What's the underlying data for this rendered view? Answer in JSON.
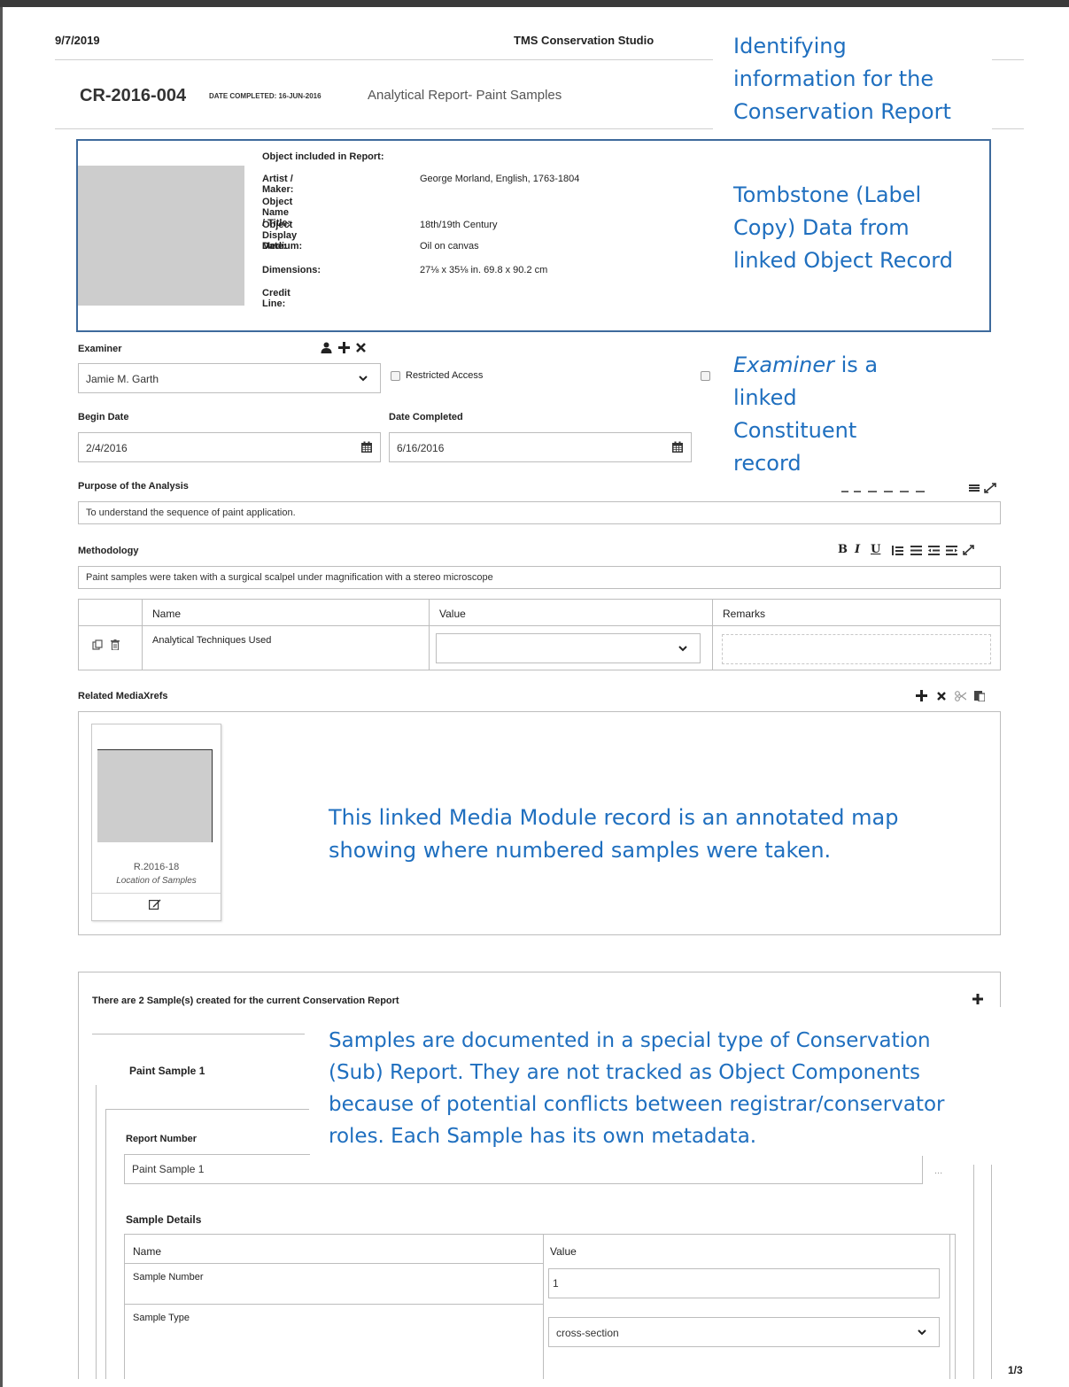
{
  "header": {
    "date": "9/7/2019",
    "studio": "TMS Conservation Studio",
    "report_id": "CR-2016-004",
    "date_completed_label": "DATE COMPLETED: 16-JUN-2016",
    "report_title": "Analytical Report- Paint Samples"
  },
  "annotations": {
    "identifying": [
      "Identifying",
      "information for the",
      "Conservation Report"
    ],
    "tombstone": [
      "Tombstone (Label",
      "Copy) Data from",
      "linked Object Record"
    ],
    "examiner_em": "Examiner",
    "examiner_rest": " is a",
    "examiner_lines": [
      "linked",
      "Constituent",
      "record"
    ],
    "media": [
      "This linked Media Module record is an annotated map",
      "showing where numbered samples were taken."
    ],
    "samples": [
      "Samples are documented in a special type of Conservation",
      "(Sub) Report.  They are not tracked as Object Components",
      "because of potential conflicts between registrar/conservator",
      "roles.  Each Sample has its own metadata."
    ]
  },
  "object": {
    "heading": "Object included in Report:",
    "rows": [
      {
        "label": "Artist / Maker:",
        "value": "George Morland, English, 1763-1804"
      },
      {
        "label": "Object Name / Title:",
        "value": ""
      },
      {
        "label": "Object Display Date:",
        "value": "18th/19th Century"
      },
      {
        "label": "Medium:",
        "value": "Oil on canvas"
      },
      {
        "label": "Dimensions:",
        "value": "27⅛ x 35⅛ in. 69.8 x 90.2 cm"
      },
      {
        "label": "Credit Line:",
        "value": ""
      }
    ]
  },
  "form": {
    "examiner_label": "Examiner",
    "examiner_value": "Jamie M. Garth",
    "restricted_label": "Restricted Access",
    "begin_date_label": "Begin Date",
    "begin_date_value": "2/4/2016",
    "date_completed_label": "Date Completed",
    "date_completed_value": "6/16/2016",
    "purpose_label": "Purpose of the Analysis",
    "purpose_value": "To understand the sequence of paint application.",
    "methodology_label": "Methodology",
    "methodology_value": "Paint samples were taken with a surgical scalpel under magnification with a stereo microscope",
    "toolbar": [
      "B",
      "I",
      "U"
    ]
  },
  "attributes_table": {
    "headers": [
      "Name",
      "Value",
      "Remarks"
    ],
    "rows": [
      {
        "name": "Analytical Techniques Used",
        "value": "",
        "remarks": ""
      }
    ]
  },
  "media": {
    "label": "Related MediaXrefs",
    "item_number": "R.2016-18",
    "item_caption": "Location of Samples"
  },
  "samples": {
    "summary": "There are 2 Sample(s) created for the current Conservation Report",
    "first_title": "Paint Sample 1",
    "report_number_label": "Report Number",
    "report_number_value": "Paint Sample 1",
    "more": "...",
    "details_label": "Sample Details",
    "headers": [
      "Name",
      "Value"
    ],
    "rows": [
      {
        "name": "Sample Number",
        "value": "1"
      },
      {
        "name": "Sample Type",
        "value": "cross-section"
      }
    ]
  },
  "footer": {
    "page": "1/3"
  }
}
